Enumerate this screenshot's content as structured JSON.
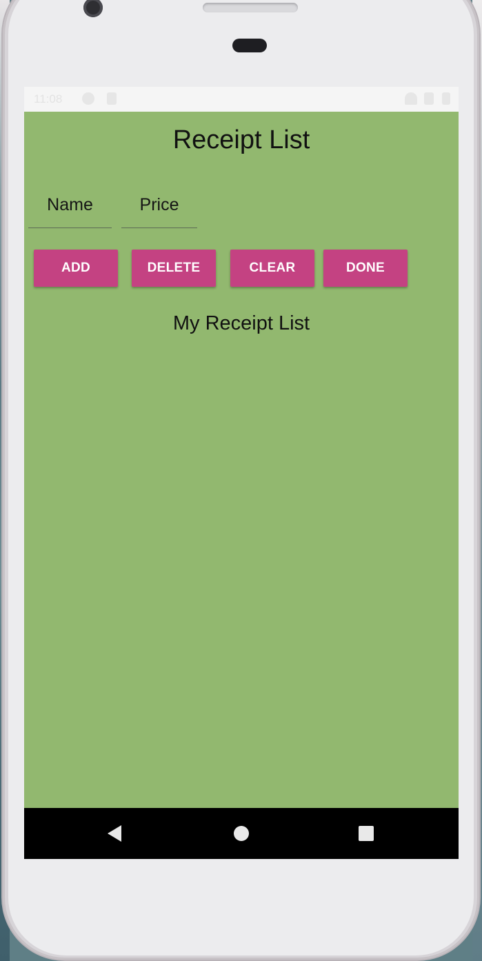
{
  "status_bar": {
    "time": "11:08"
  },
  "app": {
    "title": "Receipt List",
    "background_color": "#92b86f",
    "accent_color": "#c44282"
  },
  "form": {
    "name_placeholder": "Name",
    "price_placeholder": "Price"
  },
  "buttons": {
    "add_label": "ADD",
    "delete_label": "DELETE",
    "clear_label": "CLEAR",
    "done_label": "DONE"
  },
  "list": {
    "title": "My Receipt List",
    "items": []
  },
  "nav_bar": {
    "back_icon": "back-triangle-icon",
    "home_icon": "home-circle-icon",
    "recents_icon": "recents-square-icon"
  }
}
